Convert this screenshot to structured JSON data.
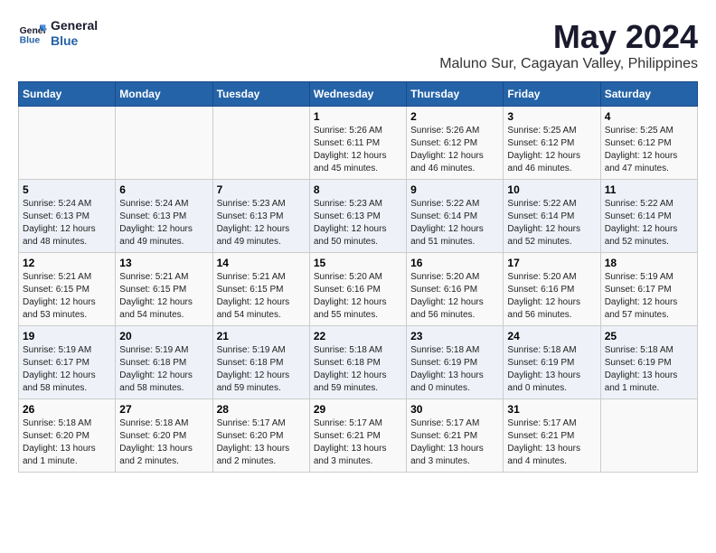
{
  "logo": {
    "line1": "General",
    "line2": "Blue"
  },
  "title": "May 2024",
  "subtitle": "Maluno Sur, Cagayan Valley, Philippines",
  "days_of_week": [
    "Sunday",
    "Monday",
    "Tuesday",
    "Wednesday",
    "Thursday",
    "Friday",
    "Saturday"
  ],
  "weeks": [
    [
      {
        "day": "",
        "info": ""
      },
      {
        "day": "",
        "info": ""
      },
      {
        "day": "",
        "info": ""
      },
      {
        "day": "1",
        "info": "Sunrise: 5:26 AM\nSunset: 6:11 PM\nDaylight: 12 hours\nand 45 minutes."
      },
      {
        "day": "2",
        "info": "Sunrise: 5:26 AM\nSunset: 6:12 PM\nDaylight: 12 hours\nand 46 minutes."
      },
      {
        "day": "3",
        "info": "Sunrise: 5:25 AM\nSunset: 6:12 PM\nDaylight: 12 hours\nand 46 minutes."
      },
      {
        "day": "4",
        "info": "Sunrise: 5:25 AM\nSunset: 6:12 PM\nDaylight: 12 hours\nand 47 minutes."
      }
    ],
    [
      {
        "day": "5",
        "info": "Sunrise: 5:24 AM\nSunset: 6:13 PM\nDaylight: 12 hours\nand 48 minutes."
      },
      {
        "day": "6",
        "info": "Sunrise: 5:24 AM\nSunset: 6:13 PM\nDaylight: 12 hours\nand 49 minutes."
      },
      {
        "day": "7",
        "info": "Sunrise: 5:23 AM\nSunset: 6:13 PM\nDaylight: 12 hours\nand 49 minutes."
      },
      {
        "day": "8",
        "info": "Sunrise: 5:23 AM\nSunset: 6:13 PM\nDaylight: 12 hours\nand 50 minutes."
      },
      {
        "day": "9",
        "info": "Sunrise: 5:22 AM\nSunset: 6:14 PM\nDaylight: 12 hours\nand 51 minutes."
      },
      {
        "day": "10",
        "info": "Sunrise: 5:22 AM\nSunset: 6:14 PM\nDaylight: 12 hours\nand 52 minutes."
      },
      {
        "day": "11",
        "info": "Sunrise: 5:22 AM\nSunset: 6:14 PM\nDaylight: 12 hours\nand 52 minutes."
      }
    ],
    [
      {
        "day": "12",
        "info": "Sunrise: 5:21 AM\nSunset: 6:15 PM\nDaylight: 12 hours\nand 53 minutes."
      },
      {
        "day": "13",
        "info": "Sunrise: 5:21 AM\nSunset: 6:15 PM\nDaylight: 12 hours\nand 54 minutes."
      },
      {
        "day": "14",
        "info": "Sunrise: 5:21 AM\nSunset: 6:15 PM\nDaylight: 12 hours\nand 54 minutes."
      },
      {
        "day": "15",
        "info": "Sunrise: 5:20 AM\nSunset: 6:16 PM\nDaylight: 12 hours\nand 55 minutes."
      },
      {
        "day": "16",
        "info": "Sunrise: 5:20 AM\nSunset: 6:16 PM\nDaylight: 12 hours\nand 56 minutes."
      },
      {
        "day": "17",
        "info": "Sunrise: 5:20 AM\nSunset: 6:16 PM\nDaylight: 12 hours\nand 56 minutes."
      },
      {
        "day": "18",
        "info": "Sunrise: 5:19 AM\nSunset: 6:17 PM\nDaylight: 12 hours\nand 57 minutes."
      }
    ],
    [
      {
        "day": "19",
        "info": "Sunrise: 5:19 AM\nSunset: 6:17 PM\nDaylight: 12 hours\nand 58 minutes."
      },
      {
        "day": "20",
        "info": "Sunrise: 5:19 AM\nSunset: 6:18 PM\nDaylight: 12 hours\nand 58 minutes."
      },
      {
        "day": "21",
        "info": "Sunrise: 5:19 AM\nSunset: 6:18 PM\nDaylight: 12 hours\nand 59 minutes."
      },
      {
        "day": "22",
        "info": "Sunrise: 5:18 AM\nSunset: 6:18 PM\nDaylight: 12 hours\nand 59 minutes."
      },
      {
        "day": "23",
        "info": "Sunrise: 5:18 AM\nSunset: 6:19 PM\nDaylight: 13 hours\nand 0 minutes."
      },
      {
        "day": "24",
        "info": "Sunrise: 5:18 AM\nSunset: 6:19 PM\nDaylight: 13 hours\nand 0 minutes."
      },
      {
        "day": "25",
        "info": "Sunrise: 5:18 AM\nSunset: 6:19 PM\nDaylight: 13 hours\nand 1 minute."
      }
    ],
    [
      {
        "day": "26",
        "info": "Sunrise: 5:18 AM\nSunset: 6:20 PM\nDaylight: 13 hours\nand 1 minute."
      },
      {
        "day": "27",
        "info": "Sunrise: 5:18 AM\nSunset: 6:20 PM\nDaylight: 13 hours\nand 2 minutes."
      },
      {
        "day": "28",
        "info": "Sunrise: 5:17 AM\nSunset: 6:20 PM\nDaylight: 13 hours\nand 2 minutes."
      },
      {
        "day": "29",
        "info": "Sunrise: 5:17 AM\nSunset: 6:21 PM\nDaylight: 13 hours\nand 3 minutes."
      },
      {
        "day": "30",
        "info": "Sunrise: 5:17 AM\nSunset: 6:21 PM\nDaylight: 13 hours\nand 3 minutes."
      },
      {
        "day": "31",
        "info": "Sunrise: 5:17 AM\nSunset: 6:21 PM\nDaylight: 13 hours\nand 4 minutes."
      },
      {
        "day": "",
        "info": ""
      }
    ]
  ]
}
